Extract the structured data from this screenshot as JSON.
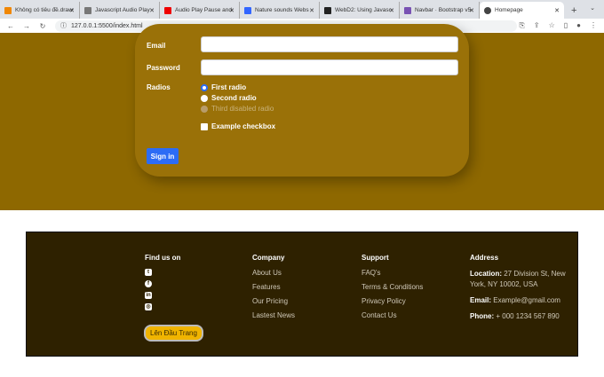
{
  "browser": {
    "tabs": [
      {
        "title": "Không có tiêu đề.draw",
        "color": "#f08705"
      },
      {
        "title": "Javascript Audio Play",
        "color": "#777"
      },
      {
        "title": "Audio Play Pause and",
        "color": "#e00"
      },
      {
        "title": "Nature sounds Webs",
        "color": "#3366ff"
      },
      {
        "title": "WebD2: Using Javasc",
        "color": "#222"
      },
      {
        "title": "Navbar · Bootstrap v5",
        "color": "#7952b3"
      },
      {
        "title": "Homepage",
        "color": "#444"
      }
    ],
    "url": "127.0.0.1:5500/index.html"
  },
  "form": {
    "email_label": "Email",
    "password_label": "Password",
    "radios_label": "Radios",
    "radio1": "First radio",
    "radio2": "Second radio",
    "radio3": "Third disabled radio",
    "checkbox": "Example checkbox",
    "submit": "Sign in"
  },
  "footer": {
    "find_us": "Find us on",
    "back_top": "Lên Đầu Trang",
    "company": {
      "title": "Company",
      "links": [
        "About Us",
        "Features",
        "Our Pricing",
        "Lastest News"
      ]
    },
    "support": {
      "title": "Support",
      "links": [
        "FAQ's",
        "Terms & Conditions",
        "Privacy Policy",
        "Contact Us"
      ]
    },
    "address": {
      "title": "Address",
      "location_label": "Location:",
      "location": "27 Division St, New York, NY 10002, USA",
      "email_label": "Email:",
      "email": "Example@gmail.com",
      "phone_label": "Phone:",
      "phone": "+ 000 1234 567 890"
    }
  }
}
